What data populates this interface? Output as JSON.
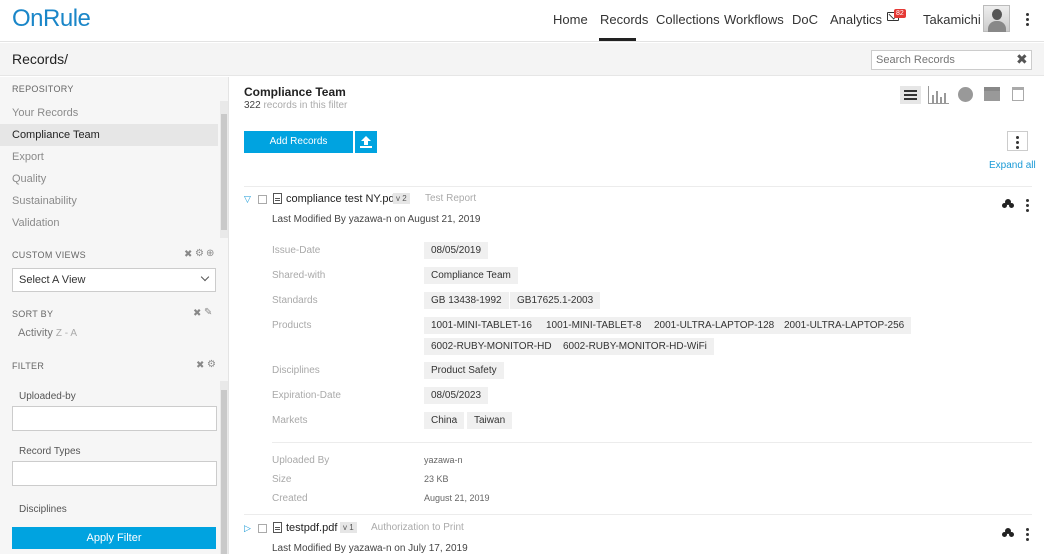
{
  "app": {
    "logo": "OnRule"
  },
  "nav": {
    "items": [
      "Home",
      "Records",
      "Collections",
      "Workflows",
      "DoC",
      "Analytics"
    ],
    "mail_count": "82",
    "user_name": "Takamichi T."
  },
  "header": {
    "title": "Records/",
    "search_placeholder": "Search Records"
  },
  "sidebar": {
    "repository_label": "REPOSITORY",
    "repository_items": [
      "Your Records",
      "Compliance Team",
      "Export",
      "Quality",
      "Sustainability",
      "Validation"
    ],
    "active_item": "Compliance Team",
    "custom_views_label": "CUSTOM VIEWS",
    "select_view": "Select A View",
    "sort_label": "SORT BY",
    "sort_field": "Activity",
    "sort_dir": "Z - A",
    "filter_label": "FILTER",
    "filters": [
      "Uploaded-by",
      "Record Types",
      "Disciplines"
    ],
    "apply_label": "Apply Filter"
  },
  "main": {
    "title": "Compliance Team",
    "count": "322",
    "count_suffix": "records in this filter",
    "add_label": "Add Records",
    "expand_label": "Expand all"
  },
  "records": [
    {
      "file": "compliance test NY.pdf",
      "version": "v 2",
      "type": "Test Report",
      "modified": "Last Modified By yazawa-n on August 21, 2019",
      "props": {
        "issue_date": {
          "label": "Issue-Date",
          "values": [
            "08/05/2019"
          ]
        },
        "shared_with": {
          "label": "Shared-with",
          "values": [
            "Compliance Team"
          ]
        },
        "standards": {
          "label": "Standards",
          "values": [
            "GB 13438-1992",
            "GB17625.1-2003"
          ]
        },
        "products": {
          "label": "Products",
          "values": [
            "1001-MINI-TABLET-16",
            "1001-MINI-TABLET-8",
            "2001-ULTRA-LAPTOP-128",
            "2001-ULTRA-LAPTOP-256",
            "6002-RUBY-MONITOR-HD",
            "6002-RUBY-MONITOR-HD-WiFi"
          ]
        },
        "disciplines": {
          "label": "Disciplines",
          "values": [
            "Product Safety"
          ]
        },
        "expiration": {
          "label": "Expiration-Date",
          "values": [
            "08/05/2023"
          ]
        },
        "markets": {
          "label": "Markets",
          "values": [
            "China",
            "Taiwan"
          ]
        }
      },
      "uploaded_by": {
        "label": "Uploaded By",
        "value": "yazawa-n"
      },
      "size": {
        "label": "Size",
        "value": "23 KB"
      },
      "created": {
        "label": "Created",
        "value": "August 21, 2019"
      }
    },
    {
      "file": "testpdf.pdf",
      "version": "v 1",
      "type": "Authorization to Print",
      "modified": "Last Modified By yazawa-n on July 17, 2019"
    }
  ],
  "colors": {
    "accent": "#00a3e0",
    "logo": "#1a86c8",
    "badge": "#e53935"
  },
  "icons": [
    "mail-icon",
    "kebab-icon",
    "close-icon",
    "list-view-icon",
    "chart-icon",
    "globe-icon",
    "archive-icon",
    "trash-icon",
    "upload-icon",
    "expand-triangle-icon",
    "document-icon",
    "group-icon",
    "gear-icon",
    "pencil-icon",
    "chevron-down-icon"
  ]
}
